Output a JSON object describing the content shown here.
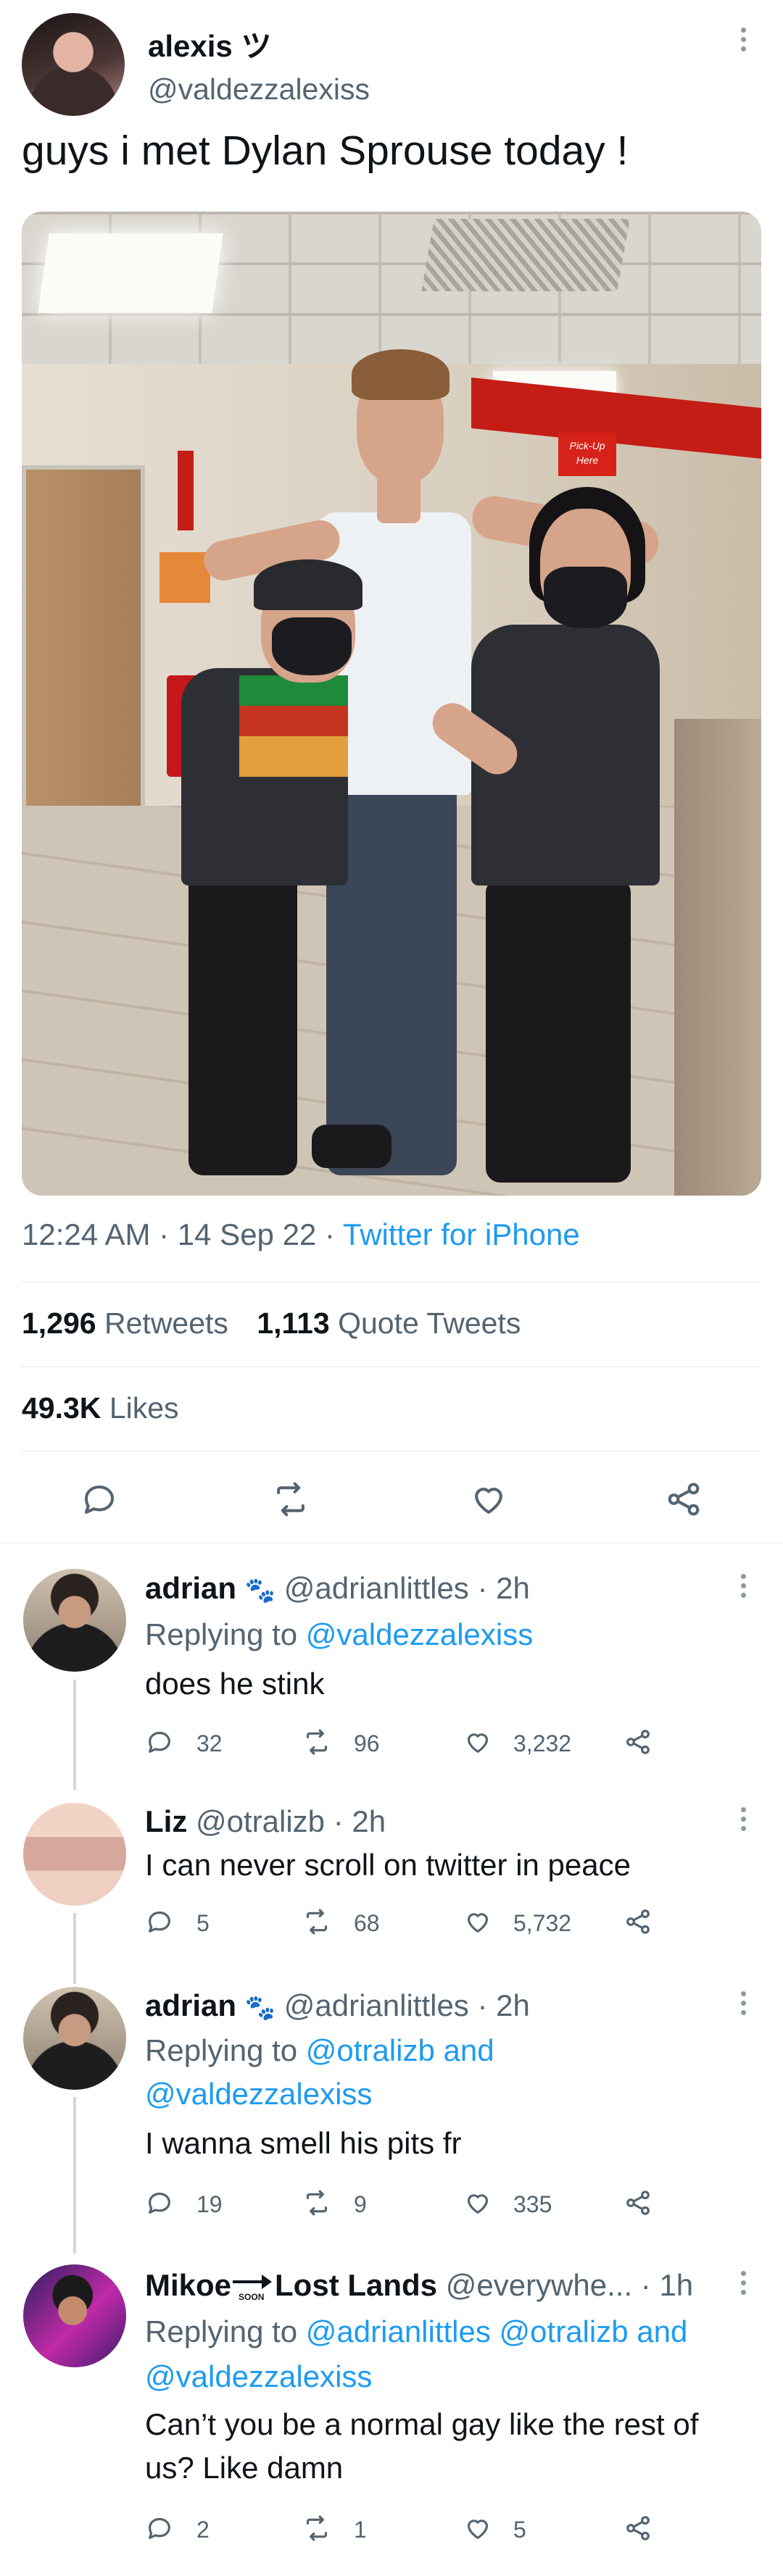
{
  "main_tweet": {
    "display_name": "alexis ツ",
    "handle": "@valdezzalexiss",
    "text": "guys i met Dylan Sprouse today !",
    "photo_sign": "Pick-Up Here",
    "time": "12:24 AM",
    "date": "14 Sep 22",
    "client": "Twitter for iPhone",
    "retweets_count": "1,296",
    "retweets_label": "Retweets",
    "quotes_count": "1,113",
    "quotes_label": "Quote Tweets",
    "likes_count": "49.3K",
    "likes_label": "Likes"
  },
  "replies": [
    {
      "name": "adrian",
      "emoji": "🐾",
      "handle": "@adrianlittles",
      "time": "· 2h",
      "replying_prefix": "Replying to",
      "replying_to": "@valdezzalexiss",
      "text": "does he stink",
      "replies": "32",
      "retweets": "96",
      "likes": "3,232"
    },
    {
      "name": "Liz",
      "handle": "@otralizb",
      "time": "· 2h",
      "text": "I can never scroll on twitter in peace",
      "replies": "5",
      "retweets": "68",
      "likes": "5,732"
    },
    {
      "name": "adrian",
      "emoji": "🐾",
      "handle": "@adrianlittles",
      "time": "· 2h",
      "replying_prefix": "Replying to",
      "replying_to_line1": "@otralizb and",
      "replying_to_line2": "@valdezzalexiss",
      "text": "I wanna smell his pits fr",
      "replies": "19",
      "retweets": "9",
      "likes": "335"
    },
    {
      "name_part1": "Mikoe",
      "name_badge": "SOON",
      "name_part2": "Lost Lands",
      "handle": "@everywhe...",
      "time": "· 1h",
      "replying_prefix": "Replying to",
      "replying_to_line1": "@adrianlittles @otralizb and",
      "replying_to_line2": "@valdezzalexiss",
      "text_line1": "Can’t you be a normal gay like the rest of",
      "text_line2": "us? Like damn",
      "replies": "2",
      "retweets": "1",
      "likes": "5"
    }
  ]
}
